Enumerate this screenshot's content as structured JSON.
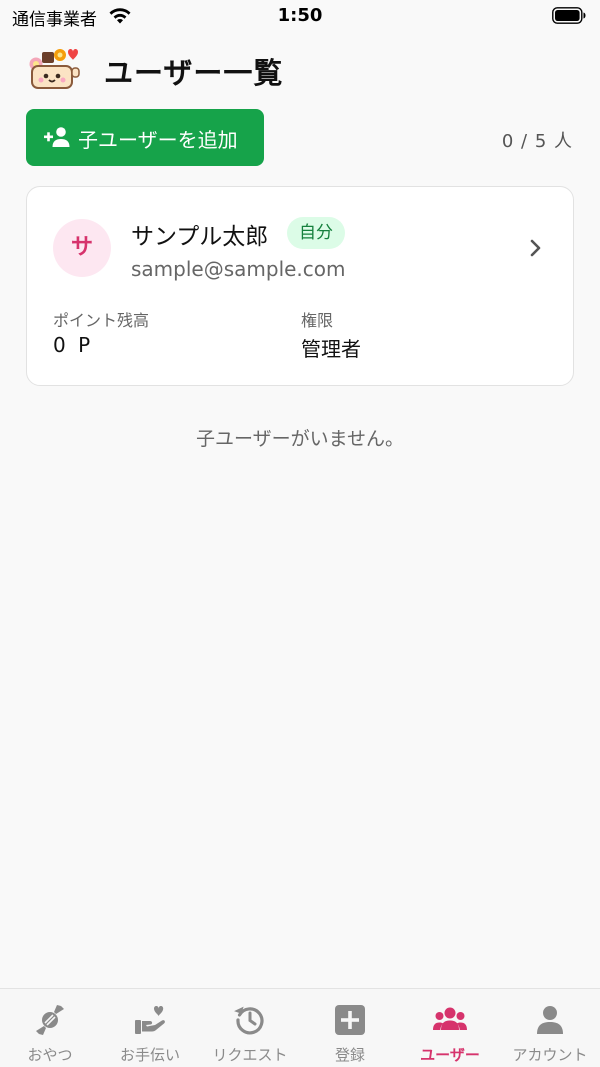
{
  "status_bar": {
    "carrier": "通信事業者",
    "time": "1:50"
  },
  "header": {
    "title": "ユーザー一覧"
  },
  "actions": {
    "add_child_label": "子ユーザーを追加",
    "count": "0 / 5 人"
  },
  "user_card": {
    "avatar_initial": "サ",
    "name": "サンプル太郎",
    "badge": "自分",
    "email": "sample@sample.com",
    "points_label": "ポイント残高",
    "points_value": "0 P",
    "role_label": "権限",
    "role_value": "管理者"
  },
  "empty_message": "子ユーザーがいません。",
  "tabs": [
    {
      "label": "おやつ",
      "icon": "candy-icon",
      "active": false
    },
    {
      "label": "お手伝い",
      "icon": "hand-heart-icon",
      "active": false
    },
    {
      "label": "リクエスト",
      "icon": "history-icon",
      "active": false
    },
    {
      "label": "登録",
      "icon": "plus-square-icon",
      "active": false
    },
    {
      "label": "ユーザー",
      "icon": "users-icon",
      "active": true
    },
    {
      "label": "アカウント",
      "icon": "person-icon",
      "active": false
    }
  ],
  "colors": {
    "primary_green": "#16a34a",
    "active_pink": "#d6336c",
    "inactive_gray": "#8a8a8a"
  }
}
